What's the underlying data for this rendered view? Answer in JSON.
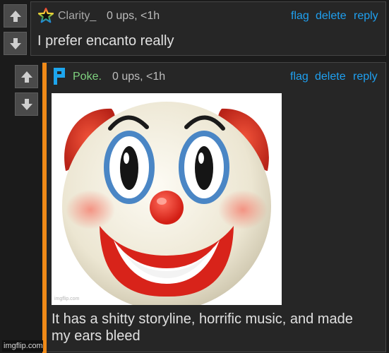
{
  "colors": {
    "link": "#1fa0f0",
    "first_user": "#a9a9a9",
    "second_user": "#7fd27f",
    "reply_bar": "#f08a18",
    "text": "#e0e0e0"
  },
  "comments": [
    {
      "username": "Clarity_",
      "user_icon": "rainbow-star-icon",
      "meta": "0 ups, <1h",
      "actions": [
        "flag",
        "delete",
        "reply"
      ],
      "text": "I prefer encanto really"
    },
    {
      "username": "Poke.",
      "user_icon": "blue-p-icon",
      "meta": "0 ups, <1h",
      "actions": [
        "flag",
        "delete",
        "reply"
      ],
      "image_watermark": "imgflip.com",
      "text_lines": [
        "It has a shitty storyline, horrific music, and made",
        "my ears bleed"
      ]
    }
  ],
  "footer_watermark": "imgflip.com"
}
